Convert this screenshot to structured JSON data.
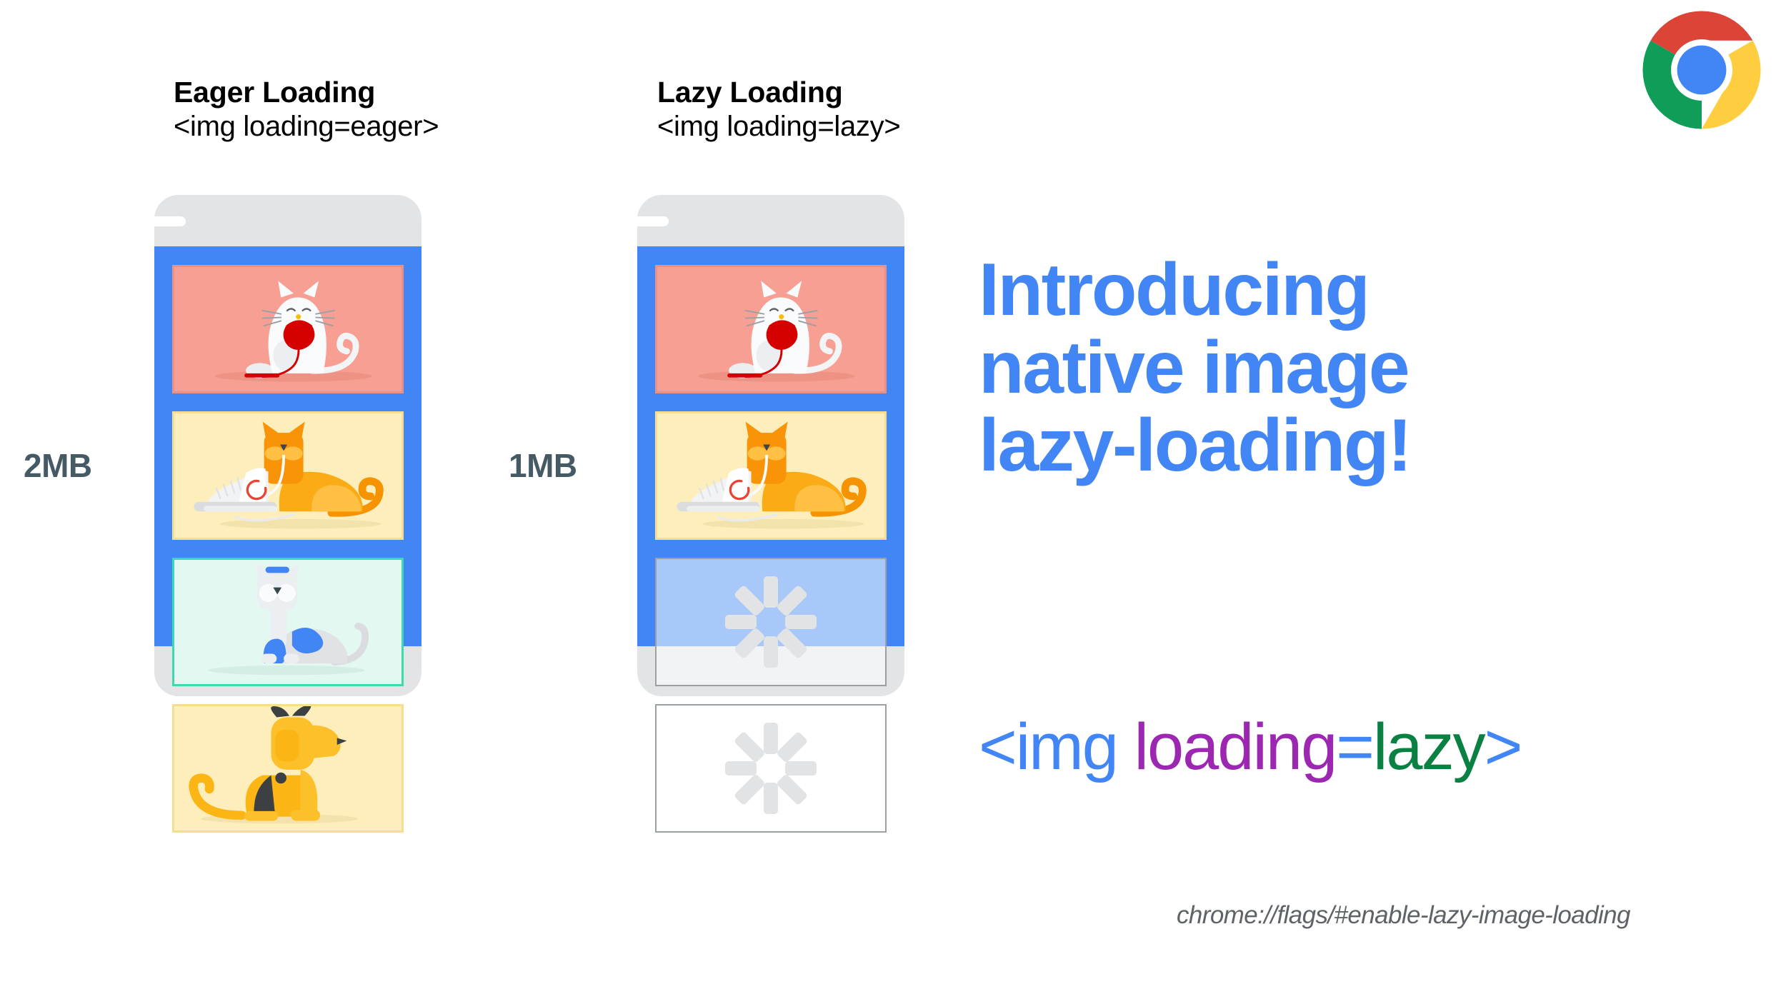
{
  "columns": [
    {
      "key": "eager",
      "title": "Eager Loading",
      "subtitle": "<img loading=eager>",
      "size_label": "2MB"
    },
    {
      "key": "lazy",
      "title": "Lazy Loading",
      "subtitle": "<img loading=lazy>",
      "size_label": "1MB"
    }
  ],
  "headline": {
    "line1": "Introducing",
    "line2": "native image",
    "line3": "lazy-loading!"
  },
  "code_snippet": {
    "open_tag": "<img",
    "attribute": "loading",
    "equals": "=",
    "value": "lazy",
    "close_tag": ">",
    "full": "<img loading=lazy>"
  },
  "flag_url": "chrome://flags/#enable-lazy-image-loading",
  "colors": {
    "brand_blue": "#4285f4",
    "phone_screen": "#4285f4",
    "phone_bezel": "#e2e4e6",
    "card_pink": "#f69f92",
    "card_yellow": "#fdeebb",
    "card_mint": "#e3f8f1",
    "mint_border": "#3fd9ae",
    "size_text": "#465a65",
    "code_purple": "#9c27b0",
    "code_green": "#0b8043",
    "url_gray": "#5f6368",
    "spinner_gray": "#e2e3e5",
    "chrome_red": "#db4437",
    "chrome_yellow": "#ffcd40",
    "chrome_green": "#0f9d58",
    "chrome_blue": "#4285f4"
  },
  "eager_cards": [
    {
      "name": "white-cat-red-yarn",
      "style": "pink"
    },
    {
      "name": "orange-cat-sneaker",
      "style": "yellow"
    },
    {
      "name": "blue-gray-cat",
      "style": "mint"
    },
    {
      "name": "yellow-dog",
      "style": "yellow"
    }
  ],
  "lazy_cards": [
    {
      "name": "white-cat-red-yarn",
      "style": "pink"
    },
    {
      "name": "orange-cat-sneaker",
      "style": "yellow"
    },
    {
      "name": "spinner-placeholder",
      "style": "placeholder"
    },
    {
      "name": "spinner-placeholder",
      "style": "placeholder"
    }
  ],
  "icons": {
    "chrome_logo": "chrome-logo-icon",
    "spinner": "loading-spinner-icon",
    "speaker": "phone-speaker-icon"
  }
}
